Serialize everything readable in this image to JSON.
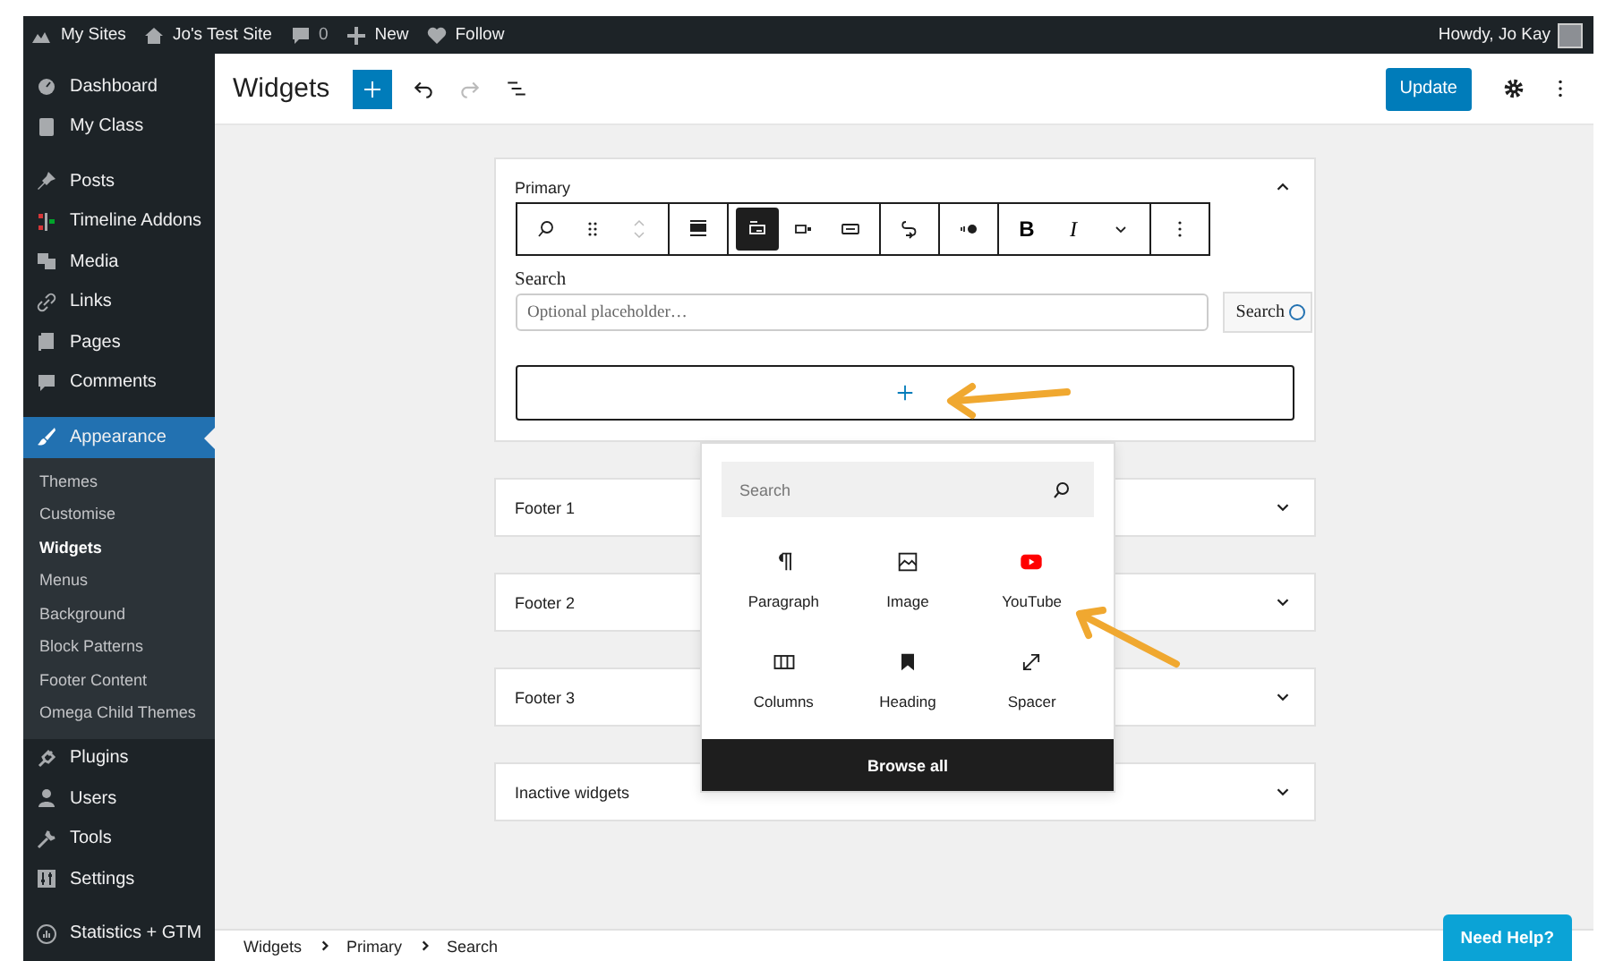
{
  "admin_bar": {
    "items": [
      {
        "kind": "sites",
        "label": "My Sites"
      },
      {
        "kind": "home",
        "label": "Jo's Test Site"
      },
      {
        "kind": "comments",
        "label": "0"
      },
      {
        "kind": "new",
        "label": "New"
      },
      {
        "kind": "follow",
        "label": "Follow"
      }
    ],
    "greeting": "Howdy, Jo Kay"
  },
  "sidebar": {
    "groups": [
      {
        "items": [
          {
            "kind": "dashboard",
            "label": "Dashboard",
            "selected": false
          },
          {
            "kind": "book",
            "label": "My Class",
            "selected": false
          }
        ]
      },
      {
        "items": [
          {
            "kind": "pin",
            "label": "Posts",
            "selected": false
          },
          {
            "kind": "timeline",
            "label": "Timeline Addons",
            "selected": false
          },
          {
            "kind": "media",
            "label": "Media",
            "selected": false
          },
          {
            "kind": "link",
            "label": "Links",
            "selected": false
          },
          {
            "kind": "pages",
            "label": "Pages",
            "selected": false
          },
          {
            "kind": "comment",
            "label": "Comments",
            "selected": false
          }
        ]
      },
      {
        "items": [
          {
            "kind": "brush",
            "label": "Appearance",
            "selected": true,
            "children": [
              {
                "label": "Themes",
                "selected": false
              },
              {
                "label": "Customise",
                "selected": false
              },
              {
                "label": "Widgets",
                "selected": true
              },
              {
                "label": "Menus",
                "selected": false
              },
              {
                "label": "Background",
                "selected": false
              },
              {
                "label": "Block Patterns",
                "selected": false
              },
              {
                "label": "Footer Content",
                "selected": false
              },
              {
                "label": "Omega Child Themes",
                "selected": false
              }
            ]
          },
          {
            "kind": "plug",
            "label": "Plugins",
            "selected": false
          },
          {
            "kind": "user",
            "label": "Users",
            "selected": false
          },
          {
            "kind": "wrench",
            "label": "Tools",
            "selected": false
          },
          {
            "kind": "settings",
            "label": "Settings",
            "selected": false
          }
        ]
      },
      {
        "items": [
          {
            "kind": "stats",
            "label": "Statistics + GTM",
            "selected": false
          }
        ]
      }
    ]
  },
  "header": {
    "title": "Widgets",
    "update_button": "Update"
  },
  "widget_areas": [
    {
      "title": "Primary",
      "expanded": true,
      "toolbar": [
        [
          {
            "kind": "search",
            "selected": false
          },
          {
            "kind": "drag",
            "selected": false
          },
          {
            "kind": "movers",
            "selected": false
          }
        ],
        [
          {
            "kind": "align",
            "selected": false
          }
        ],
        [
          {
            "kind": "button-inside",
            "selected": true
          },
          {
            "kind": "button-outside",
            "selected": false
          },
          {
            "kind": "button-only",
            "selected": false
          }
        ],
        [
          {
            "kind": "link",
            "selected": false
          }
        ],
        [
          {
            "kind": "toggle",
            "selected": false
          }
        ],
        [
          {
            "kind": "bold",
            "label": "B",
            "selected": false
          },
          {
            "kind": "italic",
            "label": "I",
            "selected": false
          },
          {
            "kind": "more",
            "selected": false
          }
        ],
        [
          {
            "kind": "options",
            "selected": false
          }
        ]
      ],
      "search_block": {
        "label": "Search",
        "placeholder": "Optional placeholder…",
        "button": "Search"
      }
    },
    {
      "title": "Footer 1",
      "expanded": false
    },
    {
      "title": "Footer 2",
      "expanded": false
    },
    {
      "title": "Footer 3",
      "expanded": false
    },
    {
      "title": "Inactive widgets",
      "expanded": false
    }
  ],
  "inserter": {
    "placeholder": "Search",
    "blocks": [
      {
        "kind": "paragraph",
        "label": "Paragraph"
      },
      {
        "kind": "image",
        "label": "Image"
      },
      {
        "kind": "youtube",
        "label": "YouTube"
      },
      {
        "kind": "columns",
        "label": "Columns"
      },
      {
        "kind": "heading",
        "label": "Heading"
      },
      {
        "kind": "spacer",
        "label": "Spacer"
      }
    ],
    "browse_all": "Browse all"
  },
  "breadcrumb": [
    "Widgets",
    "Primary",
    "Search"
  ],
  "help_button": "Need Help?"
}
